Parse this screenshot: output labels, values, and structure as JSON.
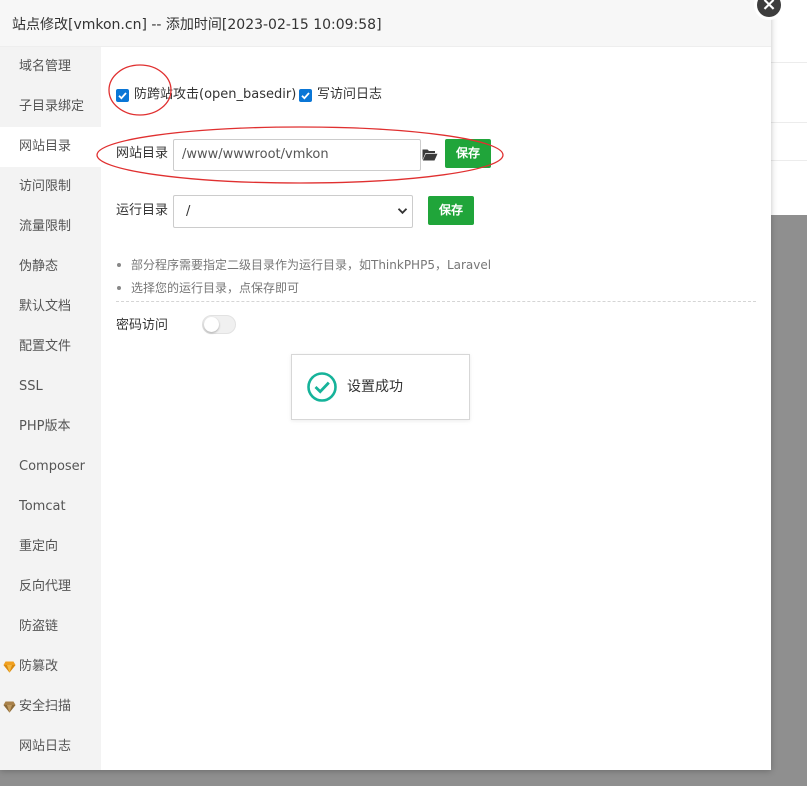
{
  "dialog": {
    "title": "站点修改[vmkon.cn] -- 添加时间[2023-02-15 10:09:58]",
    "close_icon": "close-icon"
  },
  "sidebar": {
    "items": [
      {
        "label": "域名管理",
        "active": false
      },
      {
        "label": "子目录绑定",
        "active": false
      },
      {
        "label": "网站目录",
        "active": true
      },
      {
        "label": "访问限制",
        "active": false
      },
      {
        "label": "流量限制",
        "active": false
      },
      {
        "label": "伪静态",
        "active": false
      },
      {
        "label": "默认文档",
        "active": false
      },
      {
        "label": "配置文件",
        "active": false
      },
      {
        "label": "SSL",
        "active": false
      },
      {
        "label": "PHP版本",
        "active": false
      },
      {
        "label": "Composer",
        "active": false
      },
      {
        "label": "Tomcat",
        "active": false
      },
      {
        "label": "重定向",
        "active": false
      },
      {
        "label": "反向代理",
        "active": false
      },
      {
        "label": "防盗链",
        "active": false
      },
      {
        "label": "防篡改",
        "active": false,
        "icon": "gem-icon"
      },
      {
        "label": "安全扫描",
        "active": false,
        "icon": "gem-icon"
      },
      {
        "label": "网站日志",
        "active": false
      }
    ]
  },
  "options": {
    "anti_cross_label": "防跨站攻击(open_basedir)",
    "anti_cross_checked": true,
    "access_log_label": "写访问日志",
    "access_log_checked": true
  },
  "site_dir": {
    "label": "网站目录",
    "value": "/www/wwwroot/vmkon",
    "folder_icon": "folder-open-icon",
    "save_label": "保存"
  },
  "run_dir": {
    "label": "运行目录",
    "selected": "/",
    "save_label": "保存"
  },
  "notes": [
    "部分程序需要指定二级目录作为运行目录，如ThinkPHP5，Laravel",
    "选择您的运行目录，点保存即可"
  ],
  "password_access": {
    "label": "密码访问",
    "enabled": false
  },
  "toast": {
    "icon": "check-circle-icon",
    "message": "设置成功"
  },
  "colors": {
    "primary_green": "#20a53a",
    "checkbox_blue": "#0a76d6",
    "success_teal": "#16b39a",
    "annotation_red": "#e03030"
  }
}
